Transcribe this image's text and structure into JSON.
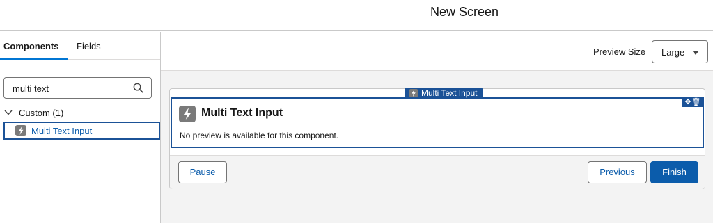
{
  "header": {
    "title": "New Screen"
  },
  "sidebar": {
    "tabs": [
      {
        "label": "Components",
        "active": true
      },
      {
        "label": "Fields",
        "active": false
      }
    ],
    "search": {
      "value": "multi text",
      "icon": "search-icon"
    },
    "group": {
      "label": "Custom (1)",
      "expanded": true
    },
    "items": [
      {
        "label": "Multi Text Input",
        "icon": "lightning-icon",
        "selected": true
      }
    ]
  },
  "toolbar": {
    "preview_size_label": "Preview Size",
    "preview_size_value": "Large"
  },
  "canvas": {
    "component_tag": "Multi Text Input",
    "component_title": "Multi Text Input",
    "component_desc": "No preview is available for this component.",
    "action_icons": [
      "move-icon",
      "trash-icon"
    ]
  },
  "footer": {
    "pause_label": "Pause",
    "previous_label": "Previous",
    "finish_label": "Finish"
  },
  "colors": {
    "brand_blue": "#0b5cab",
    "selection_navy": "#1b5297",
    "tab_accent": "#0176d3",
    "canvas_bg": "#f3f3f3"
  }
}
